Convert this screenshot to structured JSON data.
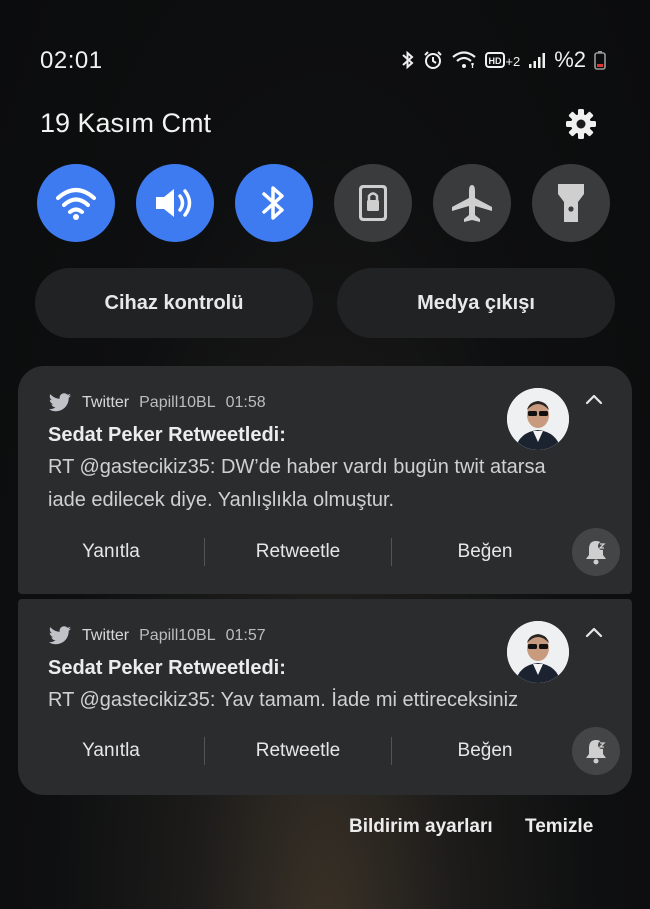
{
  "status_bar": {
    "time": "02:01",
    "battery_text": "%2",
    "icons": [
      "bluetooth-icon",
      "alarm-icon",
      "wifi-icon",
      "hd-volte-icon",
      "signal-icon",
      "battery-icon"
    ],
    "network_badge": "+2"
  },
  "date": "19 Kasım Cmt",
  "quick_toggles": [
    {
      "name": "wifi",
      "icon": "wifi-icon",
      "state": "on"
    },
    {
      "name": "sound",
      "icon": "volume-icon",
      "state": "on"
    },
    {
      "name": "bluetooth",
      "icon": "bluetooth-icon",
      "state": "on"
    },
    {
      "name": "rotation-lock",
      "icon": "lock-icon",
      "state": "off"
    },
    {
      "name": "airplane",
      "icon": "airplane-icon",
      "state": "off"
    },
    {
      "name": "flashlight",
      "icon": "flashlight-icon",
      "state": "off"
    }
  ],
  "pills": {
    "device_control": "Cihaz kontrolü",
    "media_output": "Medya çıkışı"
  },
  "notifications": [
    {
      "app": "Twitter",
      "account": "Papill10BL",
      "time": "01:58",
      "title": "Sedat Peker Retweetledi:",
      "line1": "RT @gastecikiz35: DW’de haber vardı bugün twit atarsa",
      "line2": "iade edilecek diye. Yanlışlıkla olmuştur.",
      "actions": {
        "reply": "Yanıtla",
        "retweet": "Retweetle",
        "like": "Beğen"
      }
    },
    {
      "app": "Twitter",
      "account": "Papill10BL",
      "time": "01:57",
      "title": "Sedat Peker Retweetledi:",
      "line1": "RT @gastecikiz35: Yav tamam. İade mi ettireceksiniz",
      "actions": {
        "reply": "Yanıtla",
        "retweet": "Retweetle",
        "like": "Beğen"
      }
    }
  ],
  "footer": {
    "notification_settings": "Bildirim ayarları",
    "clear": "Temizle"
  },
  "colors": {
    "toggle_on": "#3e7bf0",
    "toggle_off": "#3a3b3d",
    "card_bg": "#2b2c2e",
    "twitter": "#1da1f2"
  }
}
